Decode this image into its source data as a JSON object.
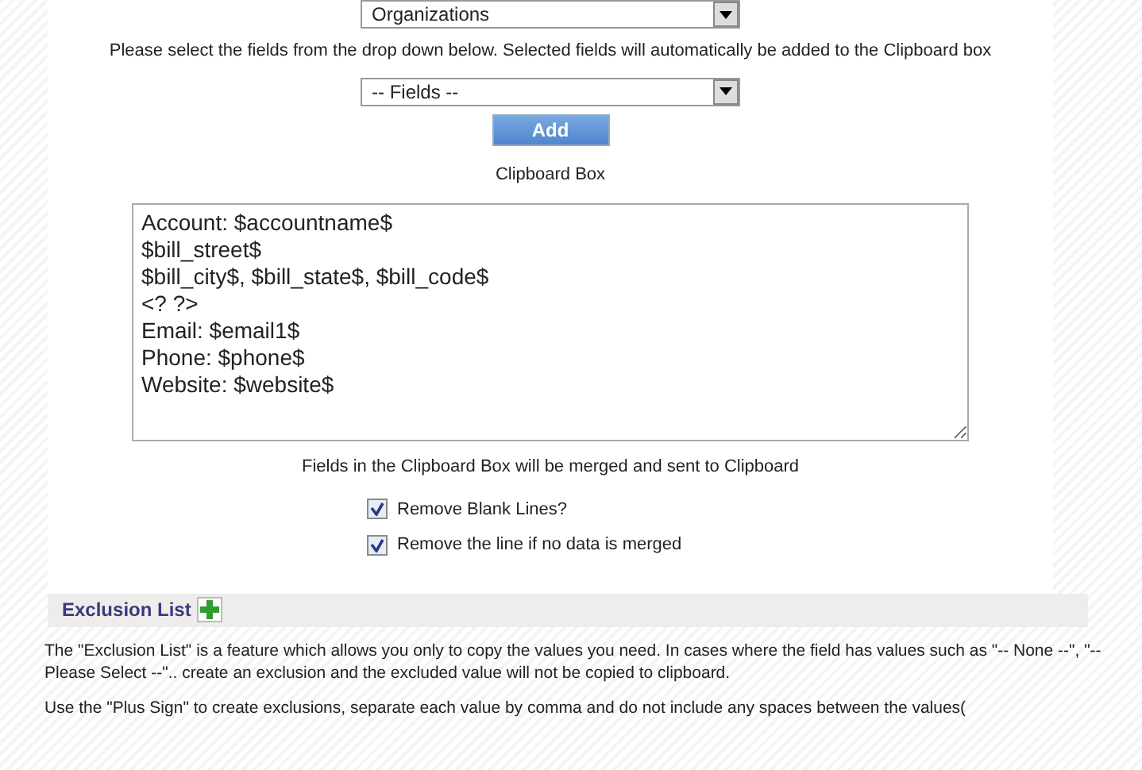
{
  "module_select": {
    "value": "Organizations"
  },
  "instructions": "Please select the fields from the drop down below. Selected fields will automatically be added to the Clipboard box",
  "fields_select": {
    "value": "-- Fields --"
  },
  "add_button": "Add",
  "clipboard_label": "Clipboard Box",
  "clipboard_text": "Account: $accountname$\n$bill_street$\n$bill_city$, $bill_state$, $bill_code$\n<? ?>\nEmail: $email1$\nPhone: $phone$\nWebsite: $website$",
  "merge_note": "Fields in the Clipboard Box will be merged and sent to Clipboard",
  "options": [
    {
      "label": "Remove Blank Lines?",
      "checked": true
    },
    {
      "label": "Remove the line if no data is merged",
      "checked": true
    }
  ],
  "exclusion": {
    "title": "Exclusion List",
    "paragraphs": [
      "The \"Exclusion List\" is a feature which allows you only to copy the values you need. In cases where the field has values such as \"-- None --\", \"-- Please Select --\".. create an exclusion and the excluded value will not be copied to clipboard.",
      "Use the \"Plus Sign\" to create exclusions, separate each value by comma and do not include any spaces between the values("
    ]
  }
}
